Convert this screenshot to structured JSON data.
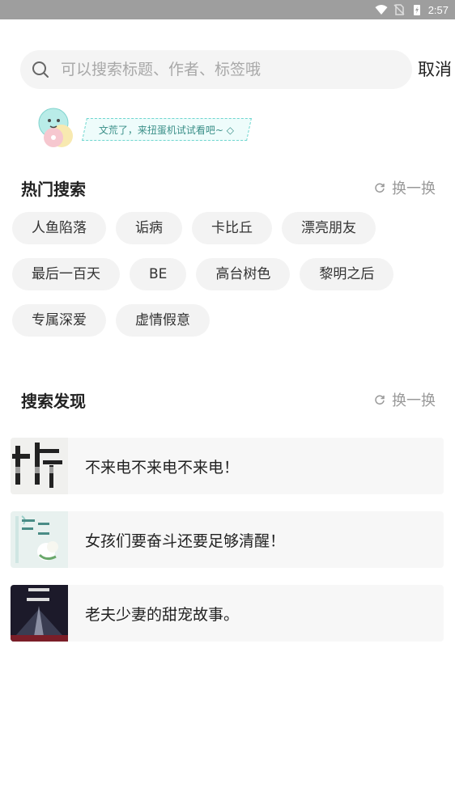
{
  "status_bar": {
    "time": "2:57"
  },
  "search": {
    "placeholder": "可以搜索标题、作者、标签哦",
    "cancel_label": "取消"
  },
  "gacha_banner": {
    "text": "文荒了，来扭蛋机试试看吧~"
  },
  "hot_search": {
    "title": "热门搜索",
    "refresh_label": "换一换",
    "tags": [
      "人鱼陷落",
      "诟病",
      "卡比丘",
      "漂亮朋友",
      "最后一百天",
      "BE",
      "高台树色",
      "黎明之后",
      "专属深爱",
      "虚情假意"
    ]
  },
  "discover": {
    "title": "搜索发现",
    "refresh_label": "换一换",
    "items": [
      {
        "text": "不来电不来电不来电！"
      },
      {
        "text": "女孩们要奋斗还要足够清醒！"
      },
      {
        "text": "老夫少妻的甜宠故事。"
      }
    ]
  }
}
